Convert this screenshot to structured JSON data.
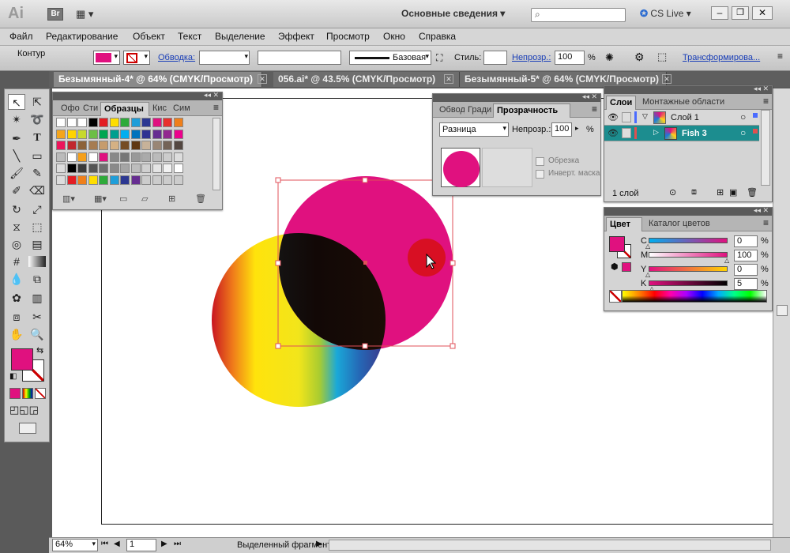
{
  "app": {
    "logo": "Ai",
    "bridge": "Br",
    "workspace": "Основные сведения",
    "cs_live": "CS Live"
  },
  "menu": [
    "Файл",
    "Редактирование",
    "Объект",
    "Текст",
    "Выделение",
    "Эффект",
    "Просмотр",
    "Окно",
    "Справка"
  ],
  "control": {
    "label": "Контур",
    "stroke_link": "Обводка:",
    "brush": "Базовая",
    "style": "Стиль:",
    "opacity_link": "Непрозр.:",
    "opacity": "100",
    "pct": "%",
    "transform": "Трансформирова..."
  },
  "tabs": [
    {
      "label": "Безымянный-4* @ 64% (CMYK/Просмотр)"
    },
    {
      "label": "056.ai* @ 43.5% (CMYK/Просмотр)"
    },
    {
      "label": "Безымянный-5* @ 64% (CMYK/Просмотр)"
    }
  ],
  "swatches": {
    "tabs": [
      "Офо",
      "Сти",
      "Образцы",
      "Кис",
      "Сим"
    ]
  },
  "transparency": {
    "tabs": [
      "Обвод",
      "Гради",
      "Прозрачность"
    ],
    "mode": "Разница",
    "opacity_label": "Непрозр.:",
    "opacity": "100",
    "pct": "%",
    "clip": "Обрезка",
    "invert": "Инверт. маска"
  },
  "layers": {
    "tabs": [
      "Слои",
      "Монтажные области"
    ],
    "rows": [
      {
        "name": "Слой 1"
      },
      {
        "name": "Fish 3"
      }
    ],
    "count": "1 слой"
  },
  "color": {
    "tabs": [
      "Цвет",
      "Каталог цветов"
    ],
    "channels": [
      {
        "label": "C",
        "value": "0",
        "pct": "%"
      },
      {
        "label": "M",
        "value": "100",
        "pct": "%"
      },
      {
        "label": "Y",
        "value": "0",
        "pct": "%"
      },
      {
        "label": "K",
        "value": "5",
        "pct": "%"
      }
    ]
  },
  "status": {
    "zoom": "64%",
    "page": "1",
    "selection": "Выделенный фрагмент"
  },
  "colors": {
    "magenta": "#e0117f",
    "red": "#d80f23"
  }
}
